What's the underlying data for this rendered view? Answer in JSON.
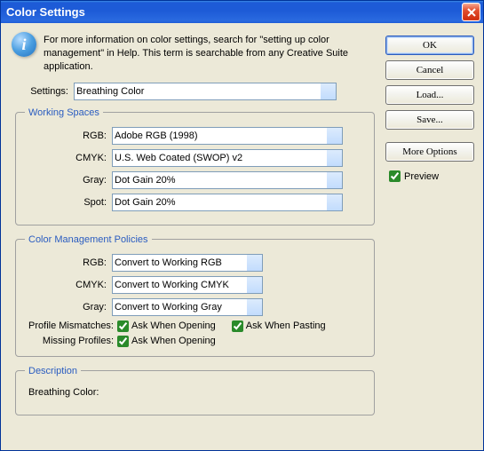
{
  "title": "Color Settings",
  "info_text": "For more information on color settings, search for \"setting up color management\" in Help. This term is searchable from any Creative Suite application.",
  "settings_label": "Settings:",
  "settings_value": "Breathing Color",
  "working_spaces": {
    "legend": "Working Spaces",
    "rgb_label": "RGB:",
    "rgb_value": "Adobe RGB (1998)",
    "cmyk_label": "CMYK:",
    "cmyk_value": "U.S. Web Coated (SWOP) v2",
    "gray_label": "Gray:",
    "gray_value": "Dot Gain 20%",
    "spot_label": "Spot:",
    "spot_value": "Dot Gain 20%"
  },
  "policies": {
    "legend": "Color Management Policies",
    "rgb_label": "RGB:",
    "rgb_value": "Convert to Working RGB",
    "cmyk_label": "CMYK:",
    "cmyk_value": "Convert to Working CMYK",
    "gray_label": "Gray:",
    "gray_value": "Convert to Working Gray",
    "mismatch_label": "Profile Mismatches:",
    "missing_label": "Missing Profiles:",
    "ask_opening": "Ask When Opening",
    "ask_pasting": "Ask When Pasting"
  },
  "description": {
    "legend": "Description",
    "text": "Breathing Color:"
  },
  "buttons": {
    "ok": "OK",
    "cancel": "Cancel",
    "load": "Load...",
    "save": "Save...",
    "more": "More Options"
  },
  "preview_label": "Preview"
}
